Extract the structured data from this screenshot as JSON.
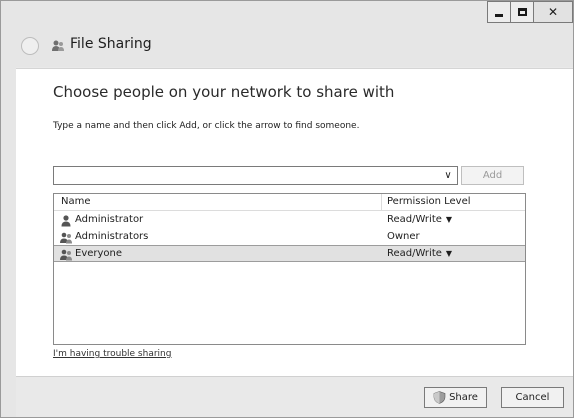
{
  "window": {
    "title": "File Sharing",
    "controls": {
      "minimize": "minimize-icon",
      "maximize": "maximize-icon",
      "close": "close-icon"
    }
  },
  "main": {
    "heading": "Choose people on your network to share with",
    "instruction": "Type a name and then click Add, or click the arrow to find someone.",
    "name_input_value": "",
    "add_label": "Add",
    "columns": {
      "name": "Name",
      "permission": "Permission Level"
    },
    "rows": [
      {
        "name": "Administrator",
        "permission": "Read/Write",
        "has_menu": true,
        "icon": "user-icon"
      },
      {
        "name": "Administrators",
        "permission": "Owner",
        "has_menu": false,
        "icon": "group-icon"
      },
      {
        "name": "Everyone",
        "permission": "Read/Write",
        "has_menu": true,
        "icon": "group-icon",
        "selected": true
      }
    ],
    "trouble_link": "I'm having trouble sharing"
  },
  "footer": {
    "share_label": "Share",
    "cancel_label": "Cancel"
  },
  "colors": {
    "selected_row": "#e1e1e1",
    "disabled_text": "#9a9a9a"
  }
}
